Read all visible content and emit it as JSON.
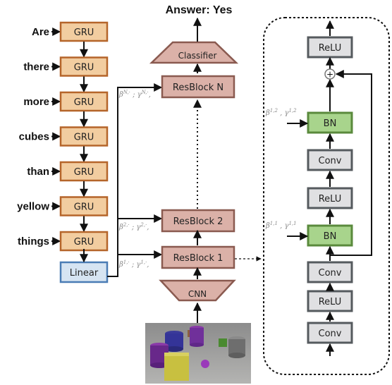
{
  "title": "Answer: Yes",
  "question_words": [
    "Are",
    "there",
    "more",
    "cubes",
    "than",
    "yellow",
    "things"
  ],
  "gru_label": "GRU",
  "linear_label": "Linear",
  "classifier_label": "Classifier",
  "cnn_label": "CNN",
  "resblocks": [
    {
      "label": "ResBlock N",
      "film_params": {
        "beta": "β",
        "beta_sup": "N,·",
        "gamma": "γ",
        "gamma_sup": "N,·"
      }
    },
    {
      "label": "ResBlock 2",
      "film_params": {
        "beta": "β",
        "beta_sup": "2,·",
        "gamma": "γ",
        "gamma_sup": "2,·"
      }
    },
    {
      "label": "ResBlock 1",
      "film_params": {
        "beta": "β",
        "beta_sup": "1,·",
        "gamma": "γ",
        "gamma_sup": "1,·"
      }
    }
  ],
  "detail": {
    "layers_top_to_bottom": [
      "ReLU",
      "BN",
      "Conv",
      "ReLU",
      "BN",
      "Conv",
      "ReLU",
      "Conv"
    ],
    "bn_params": [
      {
        "beta": "β",
        "beta_sup": "1,2",
        "gamma": "γ",
        "gamma_sup": "1,2"
      },
      {
        "beta": "β",
        "beta_sup": "1,1",
        "gamma": "γ",
        "gamma_sup": "1,1"
      }
    ],
    "sum_symbol": "+"
  },
  "colors": {
    "gru_fill": "#f2cda0",
    "gru_stroke": "#b5652a",
    "linear_fill": "#d6e4f2",
    "linear_stroke": "#4a7cb5",
    "resblock_fill": "#dbb1a8",
    "resblock_stroke": "#8a5a50",
    "bn_fill": "#a8d48c",
    "bn_stroke": "#5a8a3c",
    "layer_fill": "#e0e0e2",
    "layer_stroke": "#555a5e"
  }
}
